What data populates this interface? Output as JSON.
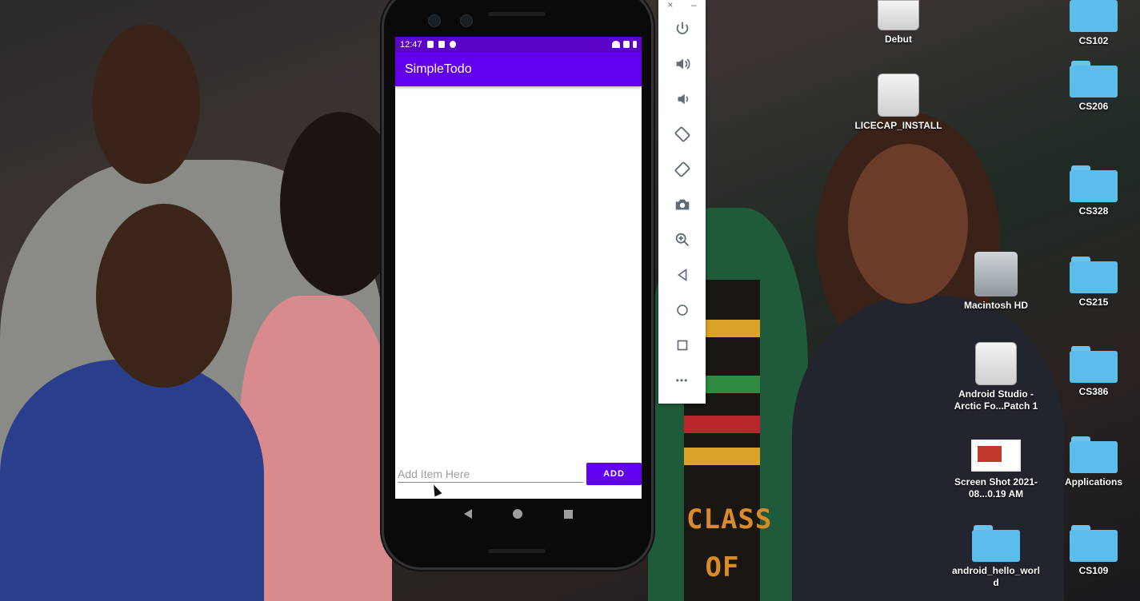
{
  "phone": {
    "status_time": "12:47",
    "app_title": "SimpleTodo",
    "input_placeholder": "Add Item Here",
    "input_value": "",
    "add_button_label": "ADD",
    "accent_color": "#6200ee",
    "status_bar_color": "#5b02c9"
  },
  "emulator_toolbar": {
    "close_label": "×",
    "minimize_label": "–",
    "buttons": [
      "power-icon",
      "volume-up-icon",
      "volume-down-icon",
      "rotate-left-icon",
      "rotate-right-icon",
      "camera-icon",
      "zoom-icon",
      "back-icon",
      "home-icon",
      "overview-icon",
      "more-icon"
    ],
    "more_label": "•••"
  },
  "desktop": {
    "photo_text_line1": "CLASS",
    "photo_text_line2": "OF",
    "icons": [
      {
        "label": "Debut",
        "type": "drive"
      },
      {
        "label": "LICECAP_INSTALL",
        "type": "drive"
      },
      {
        "label": "CS102",
        "type": "folder"
      },
      {
        "label": "CS206",
        "type": "folder"
      },
      {
        "label": "CS328",
        "type": "folder"
      },
      {
        "label": "Macintosh HD",
        "type": "hdd"
      },
      {
        "label": "CS215",
        "type": "folder"
      },
      {
        "label": "Android Studio - Arctic Fo...Patch 1",
        "type": "drive"
      },
      {
        "label": "CS386",
        "type": "folder"
      },
      {
        "label": "Screen Shot 2021-08...0.19 AM",
        "type": "screenshot"
      },
      {
        "label": "Applications",
        "type": "folder"
      },
      {
        "label": "android_hello_world",
        "type": "folder"
      },
      {
        "label": "CS109",
        "type": "folder"
      }
    ]
  }
}
